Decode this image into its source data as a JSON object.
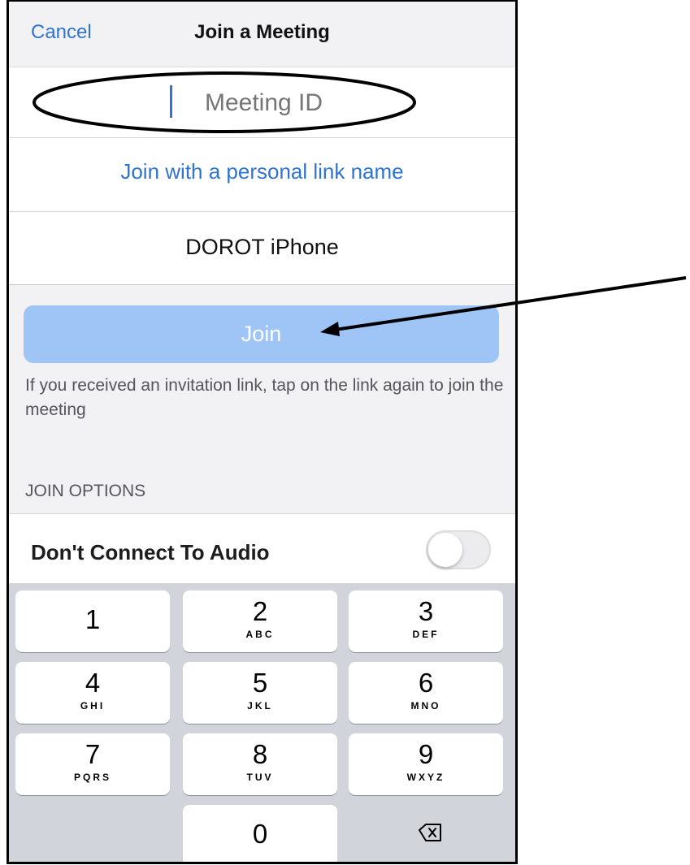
{
  "header": {
    "cancel_label": "Cancel",
    "title": "Join a Meeting"
  },
  "meeting_id": {
    "value": "",
    "placeholder": "Meeting ID"
  },
  "personal_link_label": "Join with a personal link name",
  "display_name": "DOROT iPhone",
  "join_button_label": "Join",
  "hint_text": "If you received an invitation link, tap on the link again to join the meeting",
  "join_options": {
    "section_label": "JOIN OPTIONS",
    "audio_toggle_label": "Don't Connect To Audio",
    "audio_toggle_on": false
  },
  "keypad": {
    "keys": [
      {
        "digit": "1",
        "letters": ""
      },
      {
        "digit": "2",
        "letters": "ABC"
      },
      {
        "digit": "3",
        "letters": "DEF"
      },
      {
        "digit": "4",
        "letters": "GHI"
      },
      {
        "digit": "5",
        "letters": "JKL"
      },
      {
        "digit": "6",
        "letters": "MNO"
      },
      {
        "digit": "7",
        "letters": "PQRS"
      },
      {
        "digit": "8",
        "letters": "TUV"
      },
      {
        "digit": "9",
        "letters": "WXYZ"
      },
      {
        "digit": "0",
        "letters": ""
      }
    ],
    "delete_icon": "backspace-icon"
  },
  "colors": {
    "accent": "#2f74d0",
    "join_button": "#9fc5f6",
    "keyboard_background": "#d1d4da"
  }
}
